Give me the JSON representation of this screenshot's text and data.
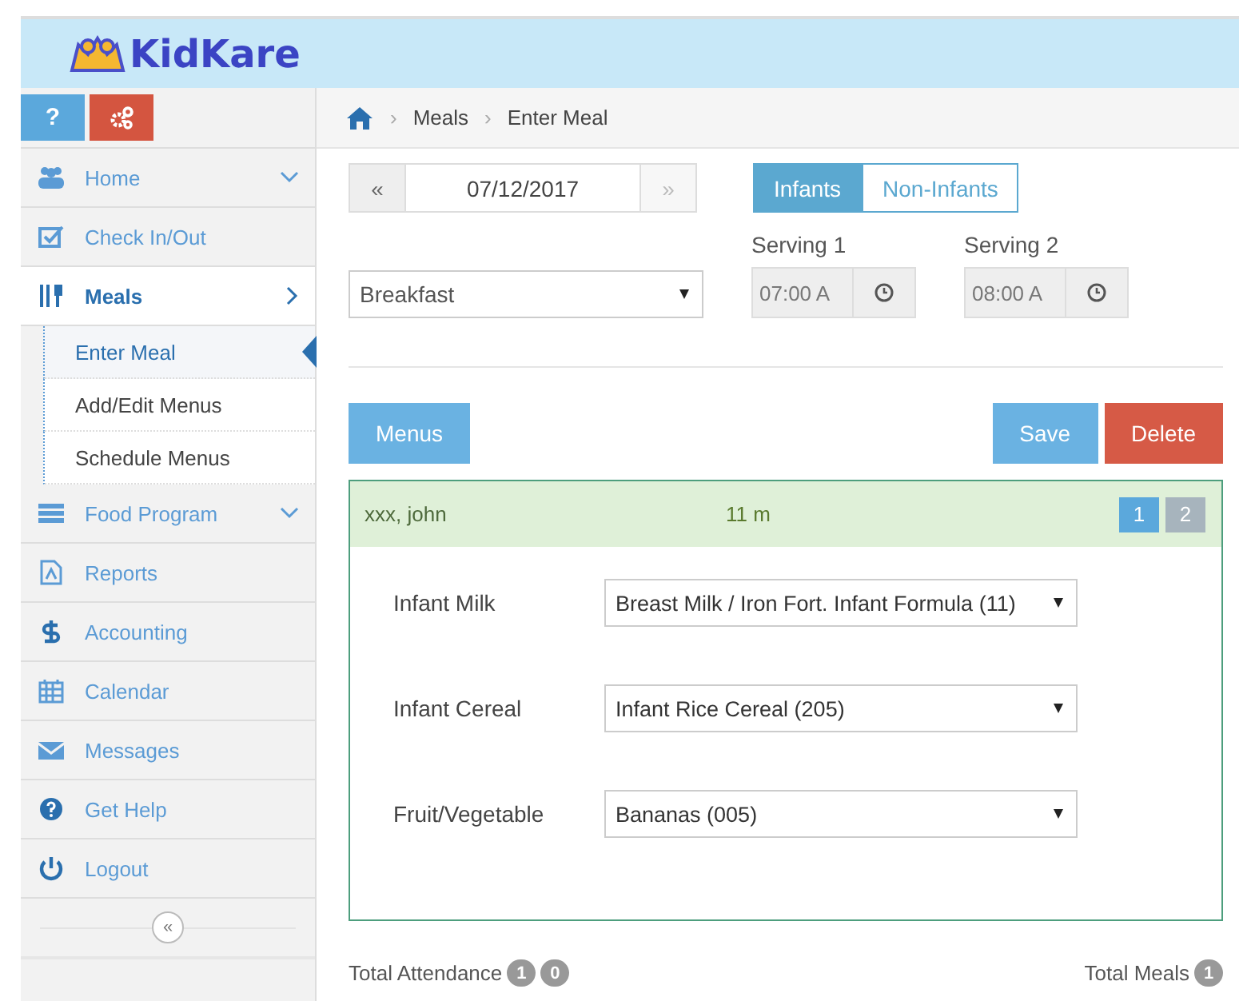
{
  "header": {
    "logo": "KidKare"
  },
  "sidebar": {
    "tools": [
      {
        "kind": "help",
        "label": "?"
      },
      {
        "kind": "settings"
      }
    ],
    "items": [
      {
        "kind": "users",
        "label": "Home",
        "expanded": false,
        "selected": false
      },
      {
        "kind": "check",
        "label": "Check In/Out",
        "selected": false
      },
      {
        "kind": "meals",
        "label": "Meals",
        "expanded": true,
        "selected": true,
        "children": [
          {
            "label": "Enter Meal",
            "selected": true
          },
          {
            "label": "Add/Edit Menus",
            "selected": false
          },
          {
            "label": "Schedule Menus",
            "selected": false
          }
        ]
      },
      {
        "kind": "food",
        "label": "Food Program",
        "expanded": false,
        "selected": false
      },
      {
        "kind": "pdf",
        "label": "Reports",
        "selected": false
      },
      {
        "kind": "dollar",
        "label": "Accounting",
        "selected": false
      },
      {
        "kind": "calendar",
        "label": "Calendar",
        "selected": false
      },
      {
        "kind": "mail",
        "label": "Messages",
        "selected": false
      },
      {
        "kind": "help",
        "label": "Get Help",
        "selected": false
      },
      {
        "kind": "power",
        "label": "Logout",
        "selected": false
      }
    ],
    "collapse": "«"
  },
  "breadcrumb": {
    "separator": "›",
    "items": [
      "Meals",
      "Enter Meal"
    ]
  },
  "date": {
    "prev": "«",
    "value": "07/12/2017",
    "next": "»"
  },
  "tabs": [
    {
      "label": "Infants",
      "selected": true
    },
    {
      "label": "Non-Infants",
      "selected": false
    }
  ],
  "meal": {
    "value": "Breakfast"
  },
  "servings": [
    {
      "label": "Serving 1",
      "value": "07:00 A"
    },
    {
      "label": "Serving 2",
      "value": "08:00 A"
    }
  ],
  "buttons": {
    "menus": "Menus",
    "save": "Save",
    "delete": "Delete"
  },
  "child": {
    "name": "xxx, john",
    "age": "11 m",
    "pages": [
      {
        "label": "1",
        "selected": true
      },
      {
        "label": "2",
        "selected": false
      }
    ],
    "components": [
      {
        "label": "Infant Milk",
        "value": "Breast Milk / Iron Fort. Infant Formula (11)"
      },
      {
        "label": "Infant Cereal",
        "value": "Infant Rice Cereal (205)"
      },
      {
        "label": "Fruit/Vegetable",
        "value": "Bananas (005)"
      }
    ]
  },
  "footer": {
    "attendance_label": "Total Attendance",
    "attendance": [
      "1",
      "0"
    ],
    "meals_label": "Total Meals",
    "meals": [
      "1"
    ]
  }
}
